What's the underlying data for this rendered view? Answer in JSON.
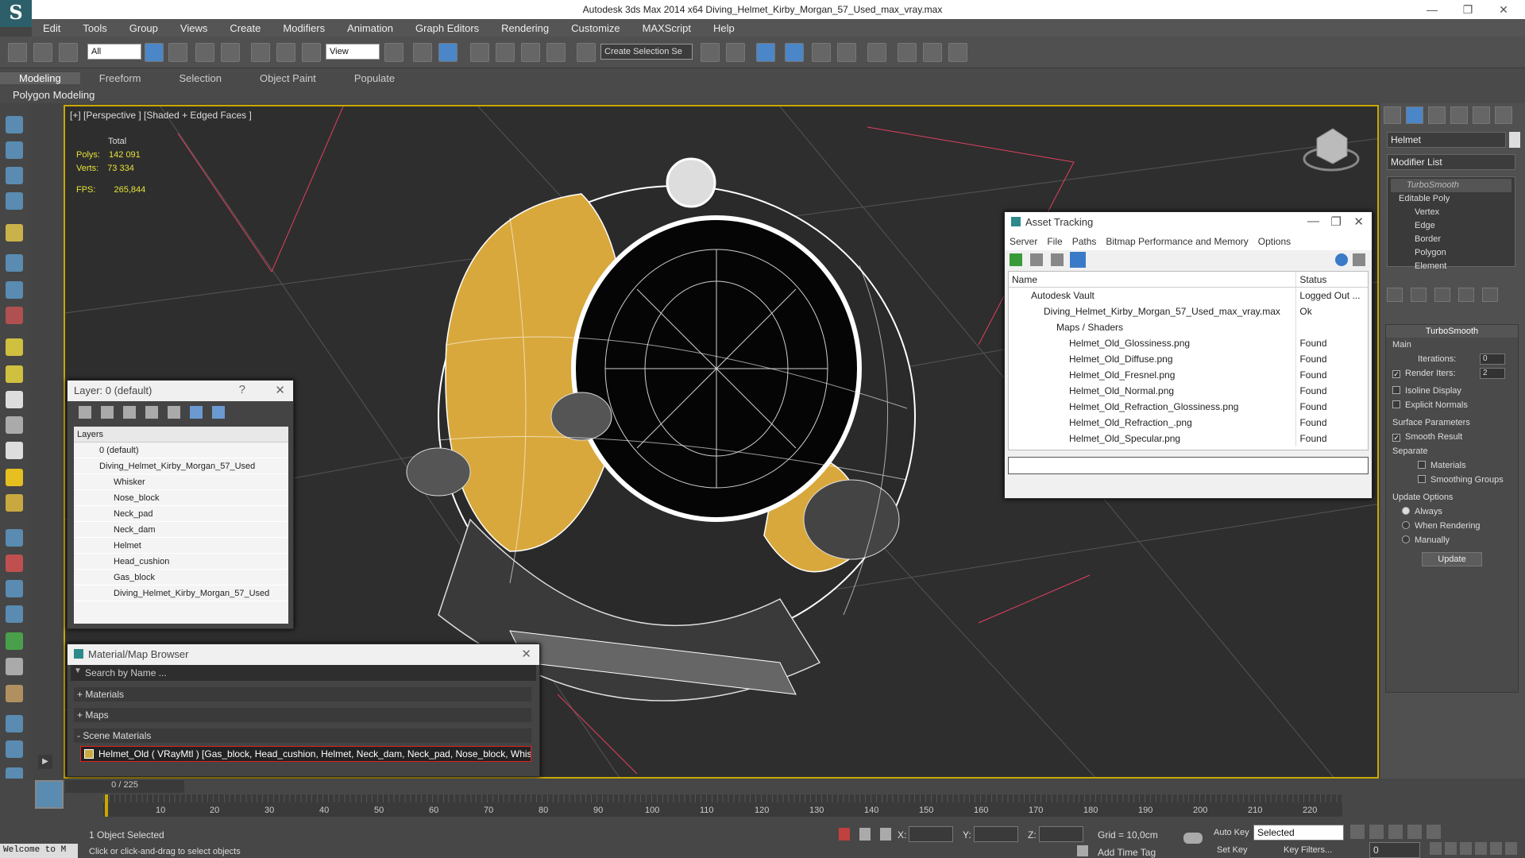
{
  "app": {
    "logo": "S",
    "title": "Autodesk 3ds Max  2014 x64    Diving_Helmet_Kirby_Morgan_57_Used_max_vray.max",
    "min": "—",
    "max": "❐",
    "close": "✕"
  },
  "menu": [
    "Edit",
    "Tools",
    "Group",
    "Views",
    "Create",
    "Modifiers",
    "Animation",
    "Graph Editors",
    "Rendering",
    "Customize",
    "MAXScript",
    "Help"
  ],
  "toolbar": {
    "filter_select": "All",
    "ref_coord_select": "View",
    "selection_set": "Create Selection Se"
  },
  "ribbon": {
    "tabs": [
      "Modeling",
      "Freeform",
      "Selection",
      "Object Paint",
      "Populate"
    ],
    "sub": "Polygon Modeling"
  },
  "viewport": {
    "label": "[+] [Perspective ] [Shaded + Edged Faces ]",
    "total_label": "Total",
    "polys_label": "Polys:",
    "polys": "142 091",
    "verts_label": "Verts:",
    "verts": "73 334",
    "fps_label": "FPS:",
    "fps": "265,844"
  },
  "command_panel": {
    "object_name": "Helmet",
    "modifier_list": "Modifier List",
    "stack": [
      "TurboSmooth",
      "Editable Poly",
      "Vertex",
      "Edge",
      "Border",
      "Polygon",
      "Element"
    ],
    "turbosmooth": {
      "title": "TurboSmooth",
      "main": "Main",
      "iterations_label": "Iterations:",
      "iterations": "0",
      "render_iters_label": "Render Iters:",
      "render_iters": "2",
      "isoline": "Isoline Display",
      "explicit_normals": "Explicit Normals",
      "surface_params": "Surface Parameters",
      "smooth_result": "Smooth Result",
      "separate": "Separate",
      "materials": "Materials",
      "smoothing_groups": "Smoothing Groups",
      "update_options": "Update Options",
      "always": "Always",
      "when_rendering": "When Rendering",
      "manually": "Manually",
      "update": "Update"
    }
  },
  "asset_tracking": {
    "title": "Asset Tracking",
    "menu": [
      "Server",
      "File",
      "Paths",
      "Bitmap Performance and Memory",
      "Options"
    ],
    "col_name": "Name",
    "col_status": "Status",
    "rows": [
      {
        "name": "Autodesk Vault",
        "status": "Logged Out ..."
      },
      {
        "name": "Diving_Helmet_Kirby_Morgan_57_Used_max_vray.max",
        "status": "Ok"
      },
      {
        "name": "Maps / Shaders",
        "status": ""
      },
      {
        "name": "Helmet_Old_Glossiness.png",
        "status": "Found"
      },
      {
        "name": "Helmet_Old_Diffuse.png",
        "status": "Found"
      },
      {
        "name": "Helmet_Old_Fresnel.png",
        "status": "Found"
      },
      {
        "name": "Helmet_Old_Normal.png",
        "status": "Found"
      },
      {
        "name": "Helmet_Old_Refraction_Glossiness.png",
        "status": "Found"
      },
      {
        "name": "Helmet_Old_Refraction_.png",
        "status": "Found"
      },
      {
        "name": "Helmet_Old_Specular.png",
        "status": "Found"
      }
    ]
  },
  "layer_panel": {
    "title": "Layer: 0 (default)",
    "help": "?",
    "header": "Layers",
    "items": [
      "0 (default)",
      "Diving_Helmet_Kirby_Morgan_57_Used",
      "Whisker",
      "Nose_block",
      "Neck_pad",
      "Neck_dam",
      "Helmet",
      "Head_cushion",
      "Gas_block",
      "Diving_Helmet_Kirby_Morgan_57_Used"
    ]
  },
  "material_browser": {
    "title": "Material/Map Browser",
    "search_placeholder": "Search by Name ...",
    "materials": "+ Materials",
    "maps": "+ Maps",
    "scene_materials": "- Scene Materials",
    "scene_item": "Helmet_Old  ( VRayMtl ) [Gas_block, Head_cushion, Helmet, Neck_dam, Neck_pad, Nose_block, Whisker]"
  },
  "timeline": {
    "frame": "0 / 225",
    "ticks": [
      "10",
      "20",
      "30",
      "40",
      "50",
      "60",
      "70",
      "80",
      "90",
      "100",
      "110",
      "120",
      "130",
      "140",
      "150",
      "160",
      "170",
      "180",
      "190",
      "200",
      "210",
      "220"
    ]
  },
  "status": {
    "welcome": "Welcome to M",
    "selected": "1 Object Selected",
    "hint": "Click or click-and-drag to select objects",
    "x_label": "X:",
    "y_label": "Y:",
    "z_label": "Z:",
    "grid": "Grid = 10,0cm",
    "add_time_tag": "Add Time Tag",
    "auto_key": "Auto Key",
    "set_key": "Set Key",
    "selected_mode": "Selected",
    "key_filters": "Key Filters...",
    "frame_field": "0"
  }
}
